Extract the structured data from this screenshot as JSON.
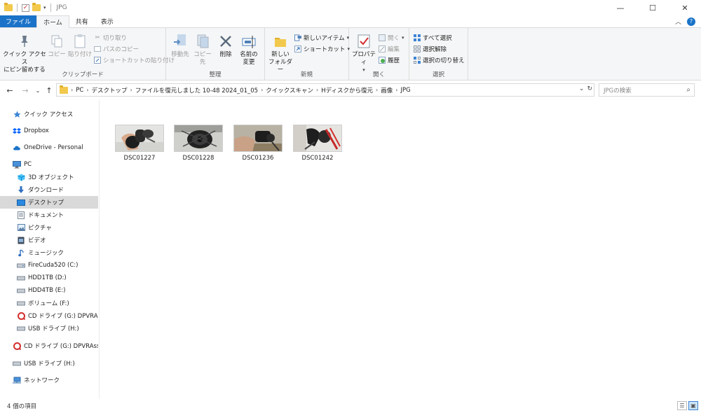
{
  "window": {
    "title": "JPG",
    "controls": {
      "minimize": "—",
      "maximize": "☐",
      "close": "✕"
    }
  },
  "tabs": {
    "file": "ファイル",
    "home": "ホーム",
    "share": "共有",
    "view": "表示"
  },
  "ribbon": {
    "clipboard": {
      "label": "クリップボード",
      "pin": "クイック アクセス\nにピン留めする",
      "copy": "コピー",
      "paste": "貼り付け",
      "cut": "切り取り",
      "copy_path": "パスのコピー",
      "paste_shortcut": "ショートカットの貼り付け"
    },
    "organize": {
      "label": "整理",
      "move_to": "移動先",
      "copy_to": "コピー先",
      "delete": "削除",
      "rename": "名前の\n変更"
    },
    "new": {
      "label": "新規",
      "new_folder": "新しい\nフォルダー",
      "new_item": "新しいアイテム",
      "shortcut": "ショートカット"
    },
    "open": {
      "label": "開く",
      "properties": "プロパティ",
      "open": "開く",
      "edit": "編集",
      "history": "履歴"
    },
    "select": {
      "label": "選択",
      "select_all": "すべて選択",
      "select_none": "選択解除",
      "invert": "選択の切り替え"
    }
  },
  "address": {
    "crumbs": [
      "PC",
      "デスクトップ",
      "ファイルを復元しました 10-48 2024_01_05",
      "クイックスキャン",
      "Hディスクから復元",
      "画像",
      "JPG"
    ],
    "search_placeholder": "JPGの検索"
  },
  "nav": {
    "items": [
      {
        "label": "クイック アクセス",
        "icon": "star-icon"
      },
      {
        "label": "Dropbox",
        "icon": "dropbox-icon"
      },
      {
        "label": "OneDrive - Personal",
        "icon": "cloud-icon"
      },
      {
        "label": "PC",
        "icon": "pc-icon"
      },
      {
        "label": "3D オブジェクト",
        "icon": "cube-icon"
      },
      {
        "label": "ダウンロード",
        "icon": "download-icon"
      },
      {
        "label": "デスクトップ",
        "icon": "desktop-icon"
      },
      {
        "label": "ドキュメント",
        "icon": "document-icon"
      },
      {
        "label": "ピクチャ",
        "icon": "picture-icon"
      },
      {
        "label": "ビデオ",
        "icon": "video-icon"
      },
      {
        "label": "ミュージック",
        "icon": "music-icon"
      },
      {
        "label": "FireCuda520 (C:)",
        "icon": "drive-icon"
      },
      {
        "label": "HDD1TB (D:)",
        "icon": "drive-icon"
      },
      {
        "label": "HDD4TB (E:)",
        "icon": "drive-icon"
      },
      {
        "label": "ボリューム (F:)",
        "icon": "drive-icon"
      },
      {
        "label": "CD ドライブ (G:) DPVRAssis",
        "icon": "cd-icon"
      },
      {
        "label": "USB ドライブ (H:)",
        "icon": "usb-icon"
      },
      {
        "label": "CD ドライブ (G:) DPVRAssista",
        "icon": "cd-icon"
      },
      {
        "label": "USB ドライブ (H:)",
        "icon": "usb-icon"
      },
      {
        "label": "ネットワーク",
        "icon": "network-icon"
      }
    ]
  },
  "files": [
    {
      "name": "DSC01227"
    },
    {
      "name": "DSC01228"
    },
    {
      "name": "DSC01236"
    },
    {
      "name": "DSC01242"
    }
  ],
  "status": {
    "count": "4 個の項目"
  },
  "colors": {
    "accent": "#1a73c8",
    "selection": "#d9d9d9",
    "folder": "#f2c94c"
  }
}
